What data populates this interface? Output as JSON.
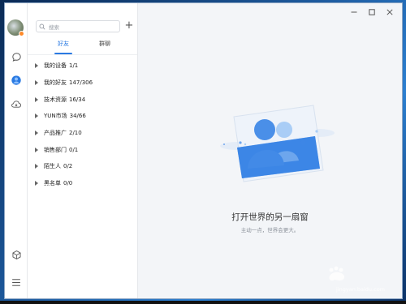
{
  "search": {
    "placeholder": "搜索"
  },
  "tabs": [
    {
      "label": "好友",
      "active": true
    },
    {
      "label": "群聊",
      "active": false
    }
  ],
  "groups": [
    {
      "label": "我的设备",
      "count": "1/1",
      "expanded": false
    },
    {
      "label": "我的好友",
      "count": "147/306",
      "expanded": false
    },
    {
      "label": "技术资源",
      "count": "16/34",
      "expanded": false
    },
    {
      "label": "YUN市场",
      "count": "34/66",
      "expanded": false
    },
    {
      "label": "产品推广",
      "count": "2/10",
      "expanded": false
    },
    {
      "label": "销售部门",
      "count": "0/1",
      "expanded": false
    },
    {
      "label": "陌生人",
      "count": "0/2",
      "expanded": false
    },
    {
      "label": "黑名单",
      "count": "0/0",
      "expanded": false
    }
  ],
  "main": {
    "title": "打开世界的另一扇窗",
    "subtitle": "主动一点，世界会更大。"
  },
  "watermark": {
    "brand": "Baidu经验",
    "url": "jingyan.baidu.com"
  },
  "icons": {
    "rail": [
      "chat-icon",
      "contacts-icon",
      "cloud-icon"
    ],
    "rail_bottom": [
      "cube-icon",
      "menu-icon"
    ]
  },
  "colors": {
    "accent": "#2a7ae2",
    "status_dot": "#ff8a2a"
  }
}
